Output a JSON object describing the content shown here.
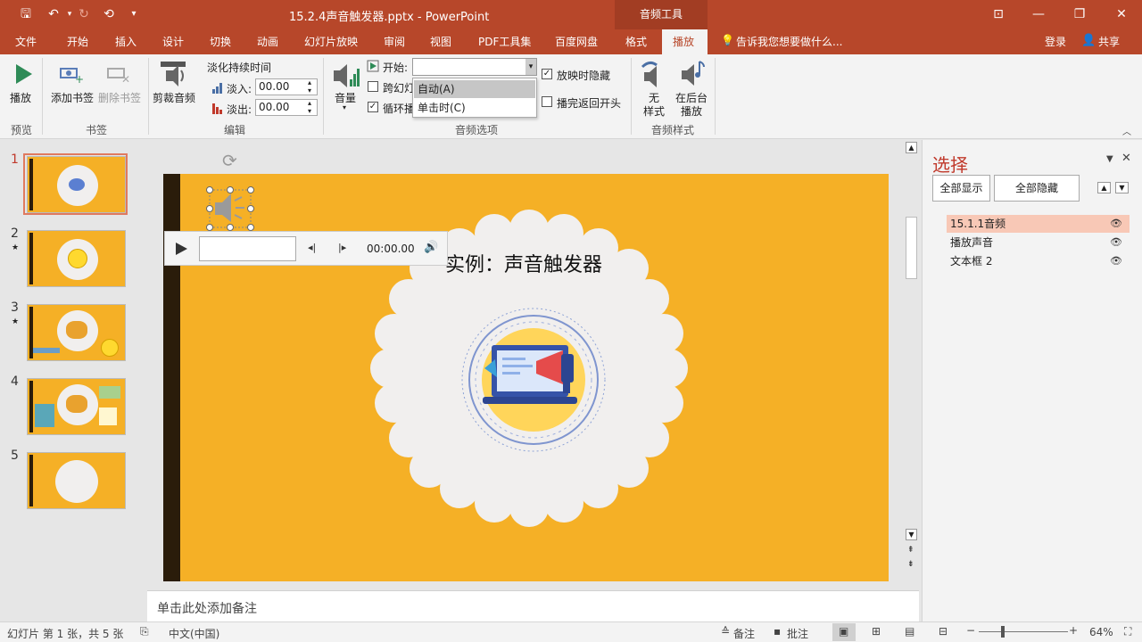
{
  "title_bar": {
    "file_title": "15.2.4声音触发器.pptx - PowerPoint",
    "context_group": "音频工具"
  },
  "tabs": [
    "文件",
    "开始",
    "插入",
    "设计",
    "切换",
    "动画",
    "幻灯片放映",
    "审阅",
    "视图",
    "PDF工具集",
    "百度网盘",
    "格式",
    "播放"
  ],
  "tell_me": "告诉我您想要做什么...",
  "login": "登录",
  "share": "共享",
  "ribbon": {
    "play_label": "播放",
    "add_bookmark": "添加书签",
    "delete_bookmark": "删除书签",
    "trim_audio": "剪裁音频",
    "fade_duration": "淡化持续时间",
    "fade_in_label": "淡入:",
    "fade_in_value": "00.00",
    "fade_out_label": "淡出:",
    "fade_out_value": "00.00",
    "volume": "音量",
    "start_label": "开始:",
    "start_options": [
      "自动(A)",
      "单击时(C)"
    ],
    "cross_slides": "跨幻灯",
    "loop": "循环播",
    "hide_during_show": "放映时隐藏",
    "rewind_after": "播完返回开头",
    "no_style_1": "无",
    "no_style_2": "样式",
    "bg_play_1": "在后台",
    "bg_play_2": "播放",
    "groups": {
      "preview": "预览",
      "bookmarks": "书签",
      "editing": "编辑",
      "audio_options": "音频选项",
      "audio_styles": "音频样式"
    }
  },
  "slides": [
    "1",
    "2",
    "3",
    "4",
    "5"
  ],
  "slide_markers": [
    "★",
    "★"
  ],
  "slide": {
    "title": "实例：声音触发器",
    "player_time": "00:00.00"
  },
  "notes_placeholder": "单击此处添加备注",
  "selection_pane": {
    "title": "选择",
    "show_all": "全部显示",
    "hide_all": "全部隐藏",
    "items": [
      "15.1.1音频",
      "播放声音",
      "文本框 2"
    ]
  },
  "status": {
    "slide_info": "幻灯片 第 1 张，共 5 张",
    "language": "中文(中国)",
    "notes": "备注",
    "comments": "批注",
    "zoom": "64%"
  },
  "colors": {
    "accent": "#b7472a",
    "slide_bg": "#f5b026"
  }
}
